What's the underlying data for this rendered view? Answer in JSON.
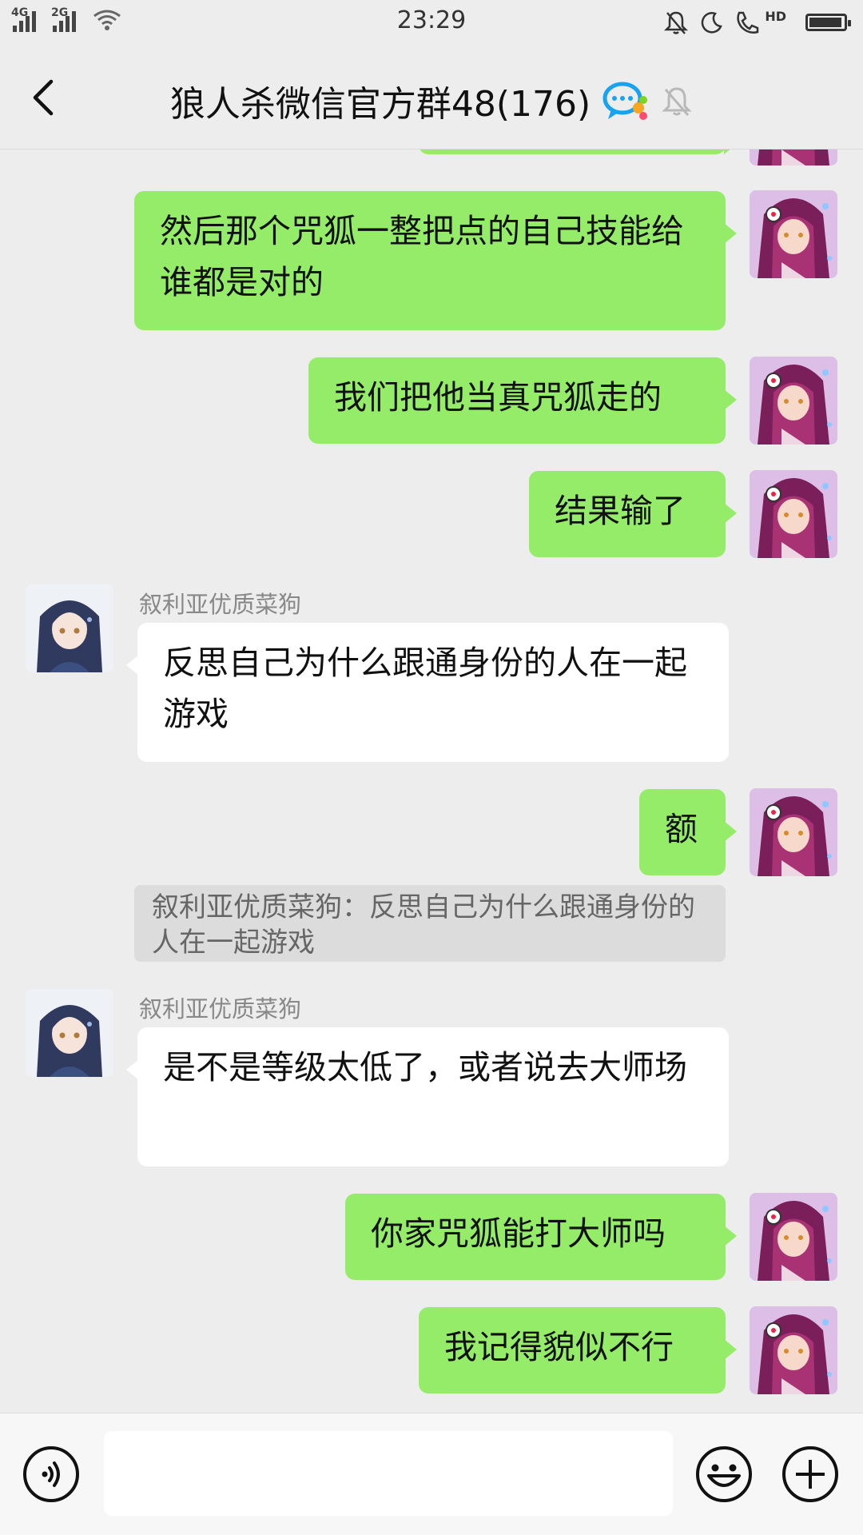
{
  "status_bar": {
    "time": "23:29",
    "sim1_label": "4G",
    "sim2_label": "2G",
    "hd_label": "HD",
    "battery_level": 0.95,
    "icons": [
      "signal-icon",
      "wifi-icon",
      "mute-bell-icon",
      "moon-icon",
      "hd-call-icon",
      "battery-icon"
    ]
  },
  "header": {
    "title": "狼人杀微信官方群48(176)",
    "icons": [
      "back-icon",
      "group-chat-icon",
      "mute-bell-icon"
    ]
  },
  "messages": [
    {
      "type": "outgoing",
      "text": "然后那个咒狐一整把点的自己技能给谁都是对的"
    },
    {
      "type": "outgoing",
      "text": "我们把他当真咒狐走的"
    },
    {
      "type": "outgoing",
      "text": "结果输了"
    },
    {
      "type": "incoming",
      "sender": "叙利亚优质菜狗",
      "text": "反思自己为什么跟通身份的人在一起游戏"
    },
    {
      "type": "outgoing",
      "text": "额",
      "quote": "叙利亚优质菜狗：反思自己为什么跟通身份的人在一起游戏"
    },
    {
      "type": "incoming",
      "sender": "叙利亚优质菜狗",
      "text": "是不是等级太低了，或者说去大师场"
    },
    {
      "type": "outgoing",
      "text": "你家咒狐能打大师吗"
    },
    {
      "type": "outgoing",
      "text": "我记得貌似不行"
    }
  ],
  "input_bar": {
    "placeholder": "",
    "icons": [
      "voice-icon",
      "emoji-icon",
      "plus-icon"
    ]
  },
  "colors": {
    "outgoing_bubble": "#95ec69",
    "incoming_bubble": "#ffffff",
    "background": "#ededed"
  }
}
